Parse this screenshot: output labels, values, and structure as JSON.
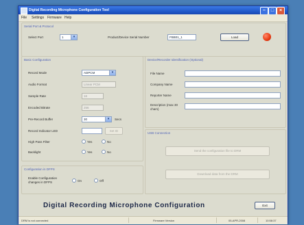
{
  "window": {
    "title": "Digital Recording Microphone Configuration Tool"
  },
  "menu": [
    "File",
    "Settings",
    "Firmware",
    "Help"
  ],
  "serial": {
    "group_title": "Serial Port & Protocol",
    "select_label": "Select Port",
    "select_value": "1",
    "vendor_label": "Product/Device Serial Number",
    "vendor_value": "FBB01_1",
    "button": "Load"
  },
  "config": {
    "group_title": "Basic Configuration",
    "record_mode_label": "Record Mode",
    "record_mode_value": "ADPCM",
    "audio_format_label": "Audio Format",
    "audio_format_value": "Linear PCM",
    "sample_rate_label": "Sample Rate",
    "sample_rate_value": "16",
    "encoded_bitrate_label": "Encoded Bitrate",
    "encoded_bitrate_value": "256",
    "preroll_label": "Pre-Record Buffer",
    "preroll_value": "30",
    "preroll_unit": "Secs",
    "record_indicator_label": "Record Indicator LED",
    "record_indicator_button": "Set ID",
    "high_pass_label": "High Pass Filter",
    "backlight_label": "Backlight",
    "yes": "Yes",
    "no": "No"
  },
  "dfpps": {
    "group_title": "Configuration in DFPS",
    "enable_label": "Enable Configuration changes in DFPS",
    "on": "On",
    "off": "Off"
  },
  "identify": {
    "group_title": "Device/Recorder Identification (Optional)",
    "file_name_label": "File Name",
    "company_label": "Company Name",
    "reporter_label": "Reporter Name",
    "description_label": "Description (max 30 chars)"
  },
  "usb": {
    "group_title": "USB Connection",
    "write_button": "Send the configuration file to DRM",
    "read_button": "Download data from the DRM"
  },
  "banner": "Digital Recording Microphone Configuration",
  "exit_button": "Exit",
  "status": {
    "left": "DRM is not connected",
    "middle": "Firmware Version",
    "date": "05-APR-2008",
    "time": "10:58:37"
  },
  "colors": {
    "title_bar": "#1f56c6",
    "accent": "#4f62b7",
    "status_led": "#e83a12"
  }
}
